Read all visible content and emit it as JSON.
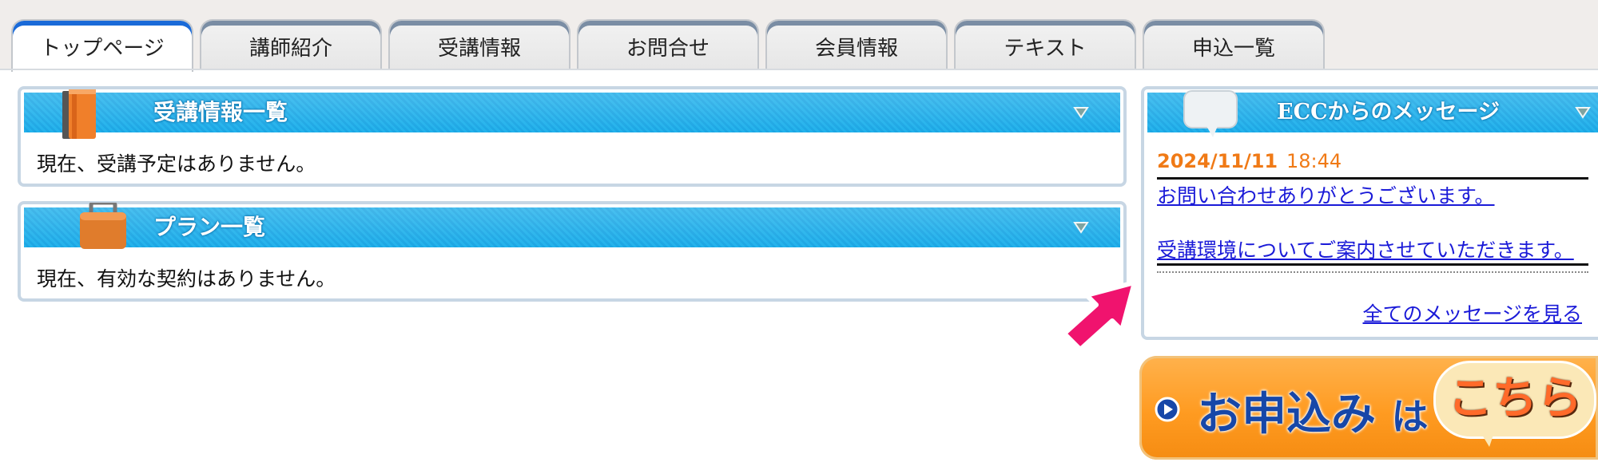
{
  "tabs": [
    {
      "label": "トップページ"
    },
    {
      "label": "講師紹介"
    },
    {
      "label": "受講情報"
    },
    {
      "label": "お問合せ"
    },
    {
      "label": "会員情報"
    },
    {
      "label": "テキスト"
    },
    {
      "label": "申込一覧"
    }
  ],
  "lessons_panel": {
    "title": "受講情報一覧",
    "message": "現在、受講予定はありません。"
  },
  "plans_panel": {
    "title": "プラン一覧",
    "message": "現在、有効な契約はありません。"
  },
  "messages_panel": {
    "title": "ECCからのメッセージ",
    "date": "2024/11/11",
    "time": "18:44",
    "message_line1": "お問い合わせありがとうございます。",
    "message_line2": "受講環境についてご案内させていただきます。",
    "view_all": "全てのメッセージを見る"
  },
  "banner": {
    "main": "お申込み",
    "particle": "は",
    "bubble": "こちら"
  },
  "colors": {
    "header_blue": "#1ba6e4",
    "date_orange": "#f07a16",
    "link_blue": "#1a1ad8",
    "arrow_pink": "#f0136e"
  }
}
